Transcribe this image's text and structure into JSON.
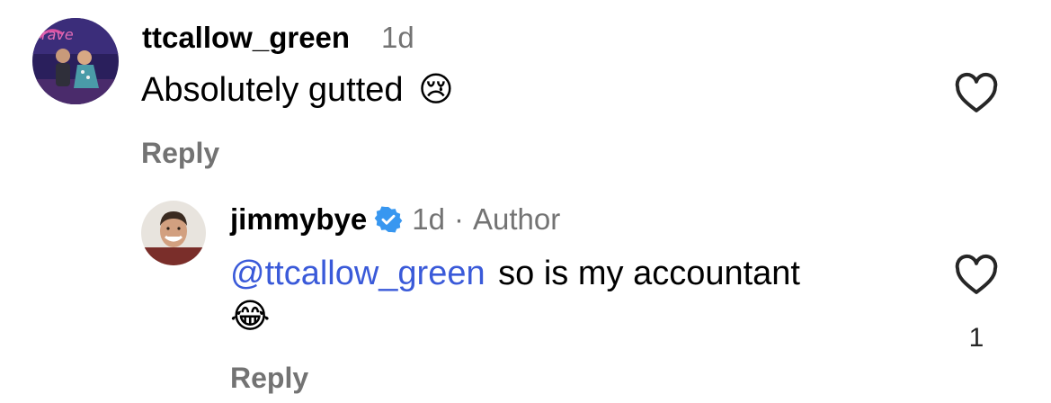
{
  "comments": [
    {
      "username": "ttcallow_green",
      "time": "1d",
      "text": "Absolutely gutted",
      "emoji": "😢",
      "reply_label": "Reply",
      "avatar_icon": "avatar-photo-couple",
      "like_icon": "heart-outline-icon"
    },
    {
      "username": "jimmybye",
      "verified": true,
      "time": "1d",
      "separator": "·",
      "role": "Author",
      "mention": "@ttcallow_green",
      "text": "so is my accountant",
      "emoji": "😂",
      "reply_label": "Reply",
      "like_count": "1",
      "avatar_icon": "avatar-photo-man",
      "like_icon": "heart-outline-icon"
    }
  ],
  "colors": {
    "mention": "#3a5ad9",
    "verified": "#3897f0",
    "secondary_text": "#737373"
  }
}
